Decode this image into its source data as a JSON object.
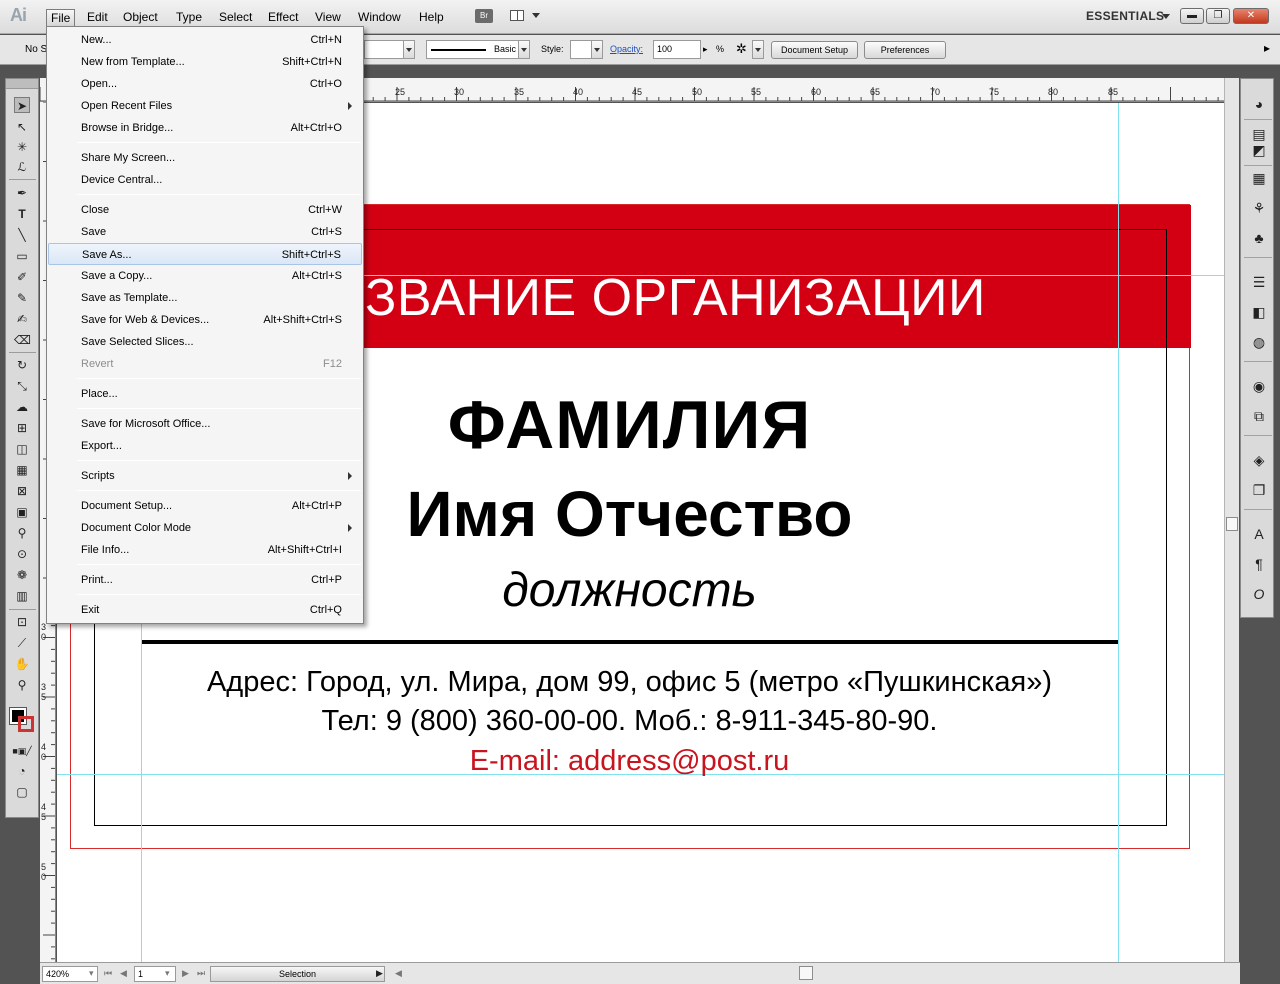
{
  "app": {
    "logo": "Ai"
  },
  "menubar": {
    "items": [
      "File",
      "Edit",
      "Object",
      "Type",
      "Select",
      "Effect",
      "View",
      "Window",
      "Help"
    ],
    "bridge_label": "Br",
    "workspace": "ESSENTIALS"
  },
  "window_controls": {
    "minimize": "▬",
    "restore": "❐",
    "close": "✕"
  },
  "controlbar": {
    "no_selection": "No S",
    "stroke_profile": "Basic",
    "style_label": "Style:",
    "opacity_label": "Opacity:",
    "opacity_value": "100",
    "opacity_unit": "%",
    "document_setup": "Document Setup",
    "preferences": "Preferences"
  },
  "file_menu": {
    "groups": [
      [
        {
          "label": "New...",
          "shortcut": "Ctrl+N"
        },
        {
          "label": "New from Template...",
          "shortcut": "Shift+Ctrl+N"
        },
        {
          "label": "Open...",
          "shortcut": "Ctrl+O"
        },
        {
          "label": "Open Recent Files",
          "shortcut": "",
          "submenu": true
        },
        {
          "label": "Browse in Bridge...",
          "shortcut": "Alt+Ctrl+O"
        }
      ],
      [
        {
          "label": "Share My Screen...",
          "shortcut": ""
        },
        {
          "label": "Device Central...",
          "shortcut": ""
        }
      ],
      [
        {
          "label": "Close",
          "shortcut": "Ctrl+W"
        },
        {
          "label": "Save",
          "shortcut": "Ctrl+S"
        },
        {
          "label": "Save As...",
          "shortcut": "Shift+Ctrl+S",
          "highlighted": true
        },
        {
          "label": "Save a Copy...",
          "shortcut": "Alt+Ctrl+S"
        },
        {
          "label": "Save as Template...",
          "shortcut": ""
        },
        {
          "label": "Save for Web & Devices...",
          "shortcut": "Alt+Shift+Ctrl+S"
        },
        {
          "label": "Save Selected Slices...",
          "shortcut": ""
        },
        {
          "label": "Revert",
          "shortcut": "F12",
          "disabled": true
        }
      ],
      [
        {
          "label": "Place...",
          "shortcut": ""
        }
      ],
      [
        {
          "label": "Save for Microsoft Office...",
          "shortcut": ""
        },
        {
          "label": "Export...",
          "shortcut": ""
        }
      ],
      [
        {
          "label": "Scripts",
          "shortcut": "",
          "submenu": true
        }
      ],
      [
        {
          "label": "Document Setup...",
          "shortcut": "Alt+Ctrl+P"
        },
        {
          "label": "Document Color Mode",
          "shortcut": "",
          "submenu": true
        },
        {
          "label": "File Info...",
          "shortcut": "Alt+Shift+Ctrl+I"
        }
      ],
      [
        {
          "label": "Print...",
          "shortcut": "Ctrl+P"
        }
      ],
      [
        {
          "label": "Exit",
          "shortcut": "Ctrl+Q"
        }
      ]
    ]
  },
  "ruler": {
    "top_labels": [
      "25",
      "30",
      "35",
      "40",
      "45",
      "50",
      "55",
      "60",
      "65",
      "70",
      "75",
      "80",
      "85"
    ],
    "left_labels": [
      "3",
      "0",
      "3",
      "5",
      "4",
      "0",
      "4",
      "5",
      "5",
      "0"
    ]
  },
  "card": {
    "org_name": "ЗВАНИЕ ОРГАНИЗАЦИИ",
    "surname": "ФАМИЛИЯ",
    "name": "Имя Отчество",
    "position": "должность",
    "address": "Адрес: Город, ул. Мира, дом 99, офис 5 (метро «Пушкинская»)",
    "phone": "Тел: 9 (800) 360-00-00. Моб.: 8-911-345-80-90.",
    "email": "E-mail: address@post.ru",
    "colors": {
      "band": "#d30013",
      "email": "#c8141e",
      "bleed": "#d72a2a",
      "guide": "#7fe2ec"
    }
  },
  "statusbar": {
    "zoom": "420%",
    "page": "1",
    "mode": "Selection"
  }
}
